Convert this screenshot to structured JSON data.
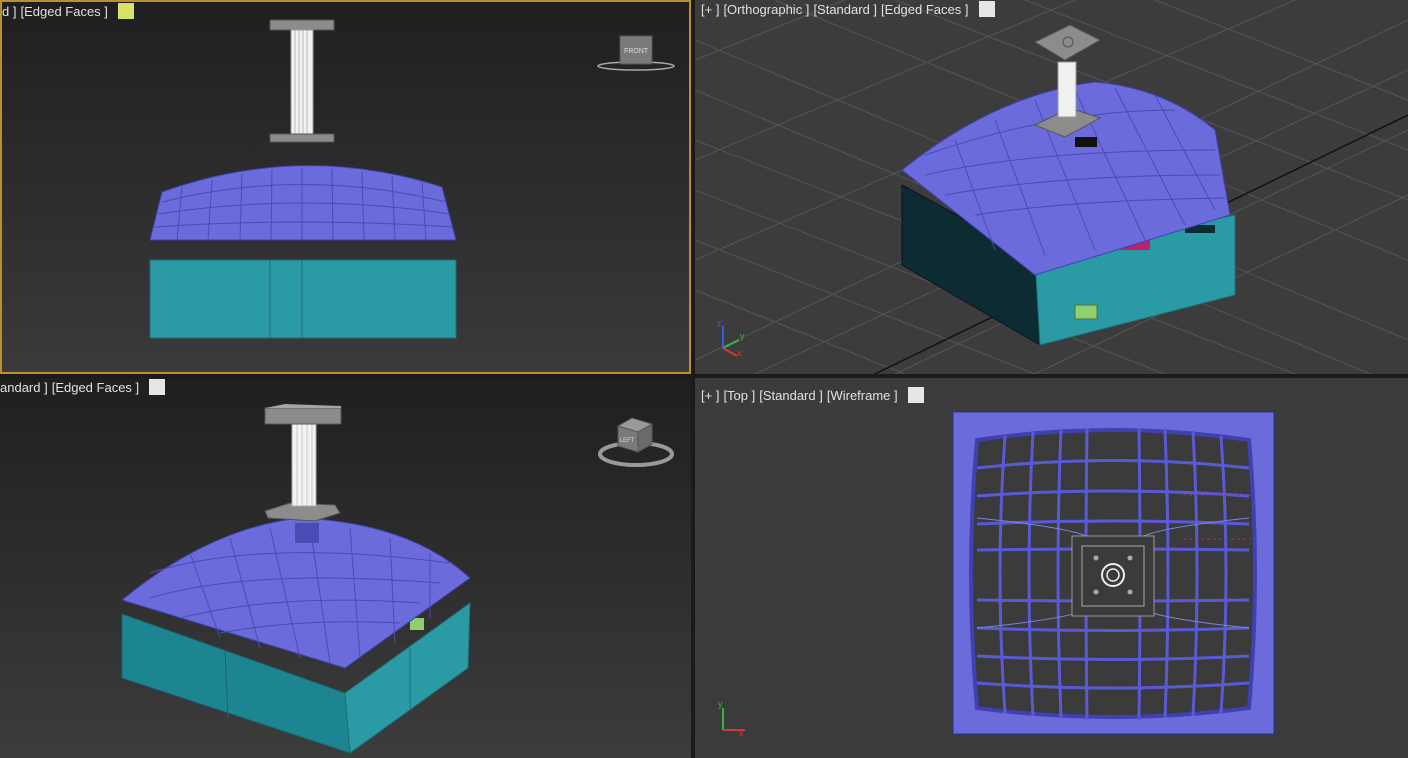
{
  "viewports": {
    "top_left": {
      "labels": [
        "d ]",
        "[Edged Faces ]"
      ],
      "swatch_color": "#d7e16a",
      "viewcube_label": "FRONT"
    },
    "top_right": {
      "labels": [
        "[+ ]",
        "[Orthographic ]",
        "[Standard ]",
        "[Edged Faces ]"
      ],
      "swatch_color": "#e6e6e6"
    },
    "bottom_left": {
      "labels": [
        "andard ]",
        "[Edged Faces ]"
      ],
      "swatch_color": "#e6e6e6",
      "viewcube_label": "LEFT"
    },
    "bottom_right": {
      "labels": [
        "[+ ]",
        "[Top ]",
        "[Standard ]",
        "[Wireframe ]"
      ],
      "swatch_color": "#e6e6e6"
    }
  },
  "axis_letters": {
    "x": "x",
    "y": "y",
    "z": "z"
  },
  "colors": {
    "roof": "#6b6bdc",
    "base": "#2a9aa5",
    "active_border": "#b8912e",
    "pillar": "#ececec",
    "plate": "#8c8c8c"
  }
}
